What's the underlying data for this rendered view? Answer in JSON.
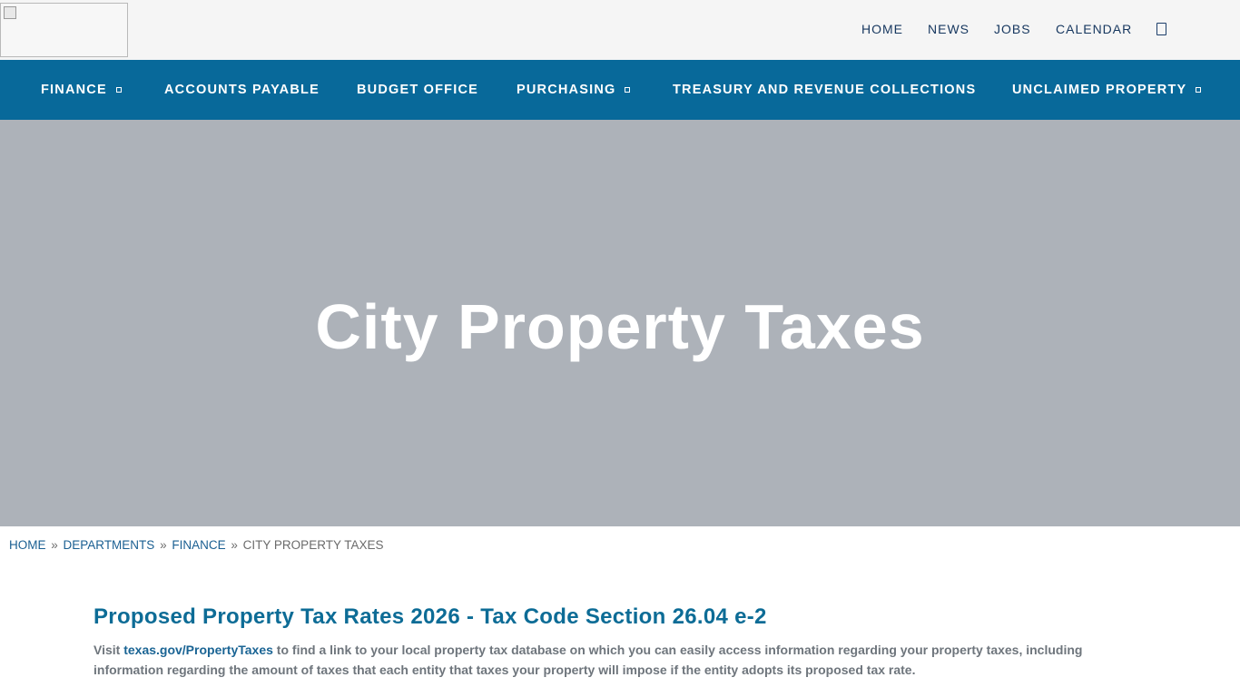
{
  "utility_nav": {
    "home": "HOME",
    "news": "NEWS",
    "jobs": "JOBS",
    "calendar": "CALENDAR"
  },
  "main_nav": {
    "items": [
      {
        "label": "FINANCE",
        "has_dropdown": true
      },
      {
        "label": "ACCOUNTS PAYABLE",
        "has_dropdown": false
      },
      {
        "label": "BUDGET OFFICE",
        "has_dropdown": false
      },
      {
        "label": "PURCHASING",
        "has_dropdown": true
      },
      {
        "label": "TREASURY AND REVENUE COLLECTIONS",
        "has_dropdown": false
      },
      {
        "label": "UNCLAIMED PROPERTY",
        "has_dropdown": true
      }
    ]
  },
  "hero": {
    "title": "City Property Taxes"
  },
  "breadcrumb": {
    "home": "HOME",
    "departments": "DEPARTMENTS",
    "finance": "FINANCE",
    "current": "CITY PROPERTY TAXES",
    "separator": "»"
  },
  "content": {
    "heading": "Proposed Property Tax Rates 2026 - Tax Code Section 26.04 e-2",
    "para_prefix": "Visit ",
    "para_link": "texas.gov/PropertyTaxes",
    "para_suffix": " to find a link to your local property tax database on which you can easily access information regarding your property taxes, including information regarding the amount of taxes that each entity that taxes your property will impose if the entity adopts its proposed tax rate."
  },
  "colors": {
    "nav_bg": "#08699a",
    "hero_bg": "#adb2b9",
    "heading": "#0d6c96",
    "topbar_bg": "#f5f5f5"
  }
}
